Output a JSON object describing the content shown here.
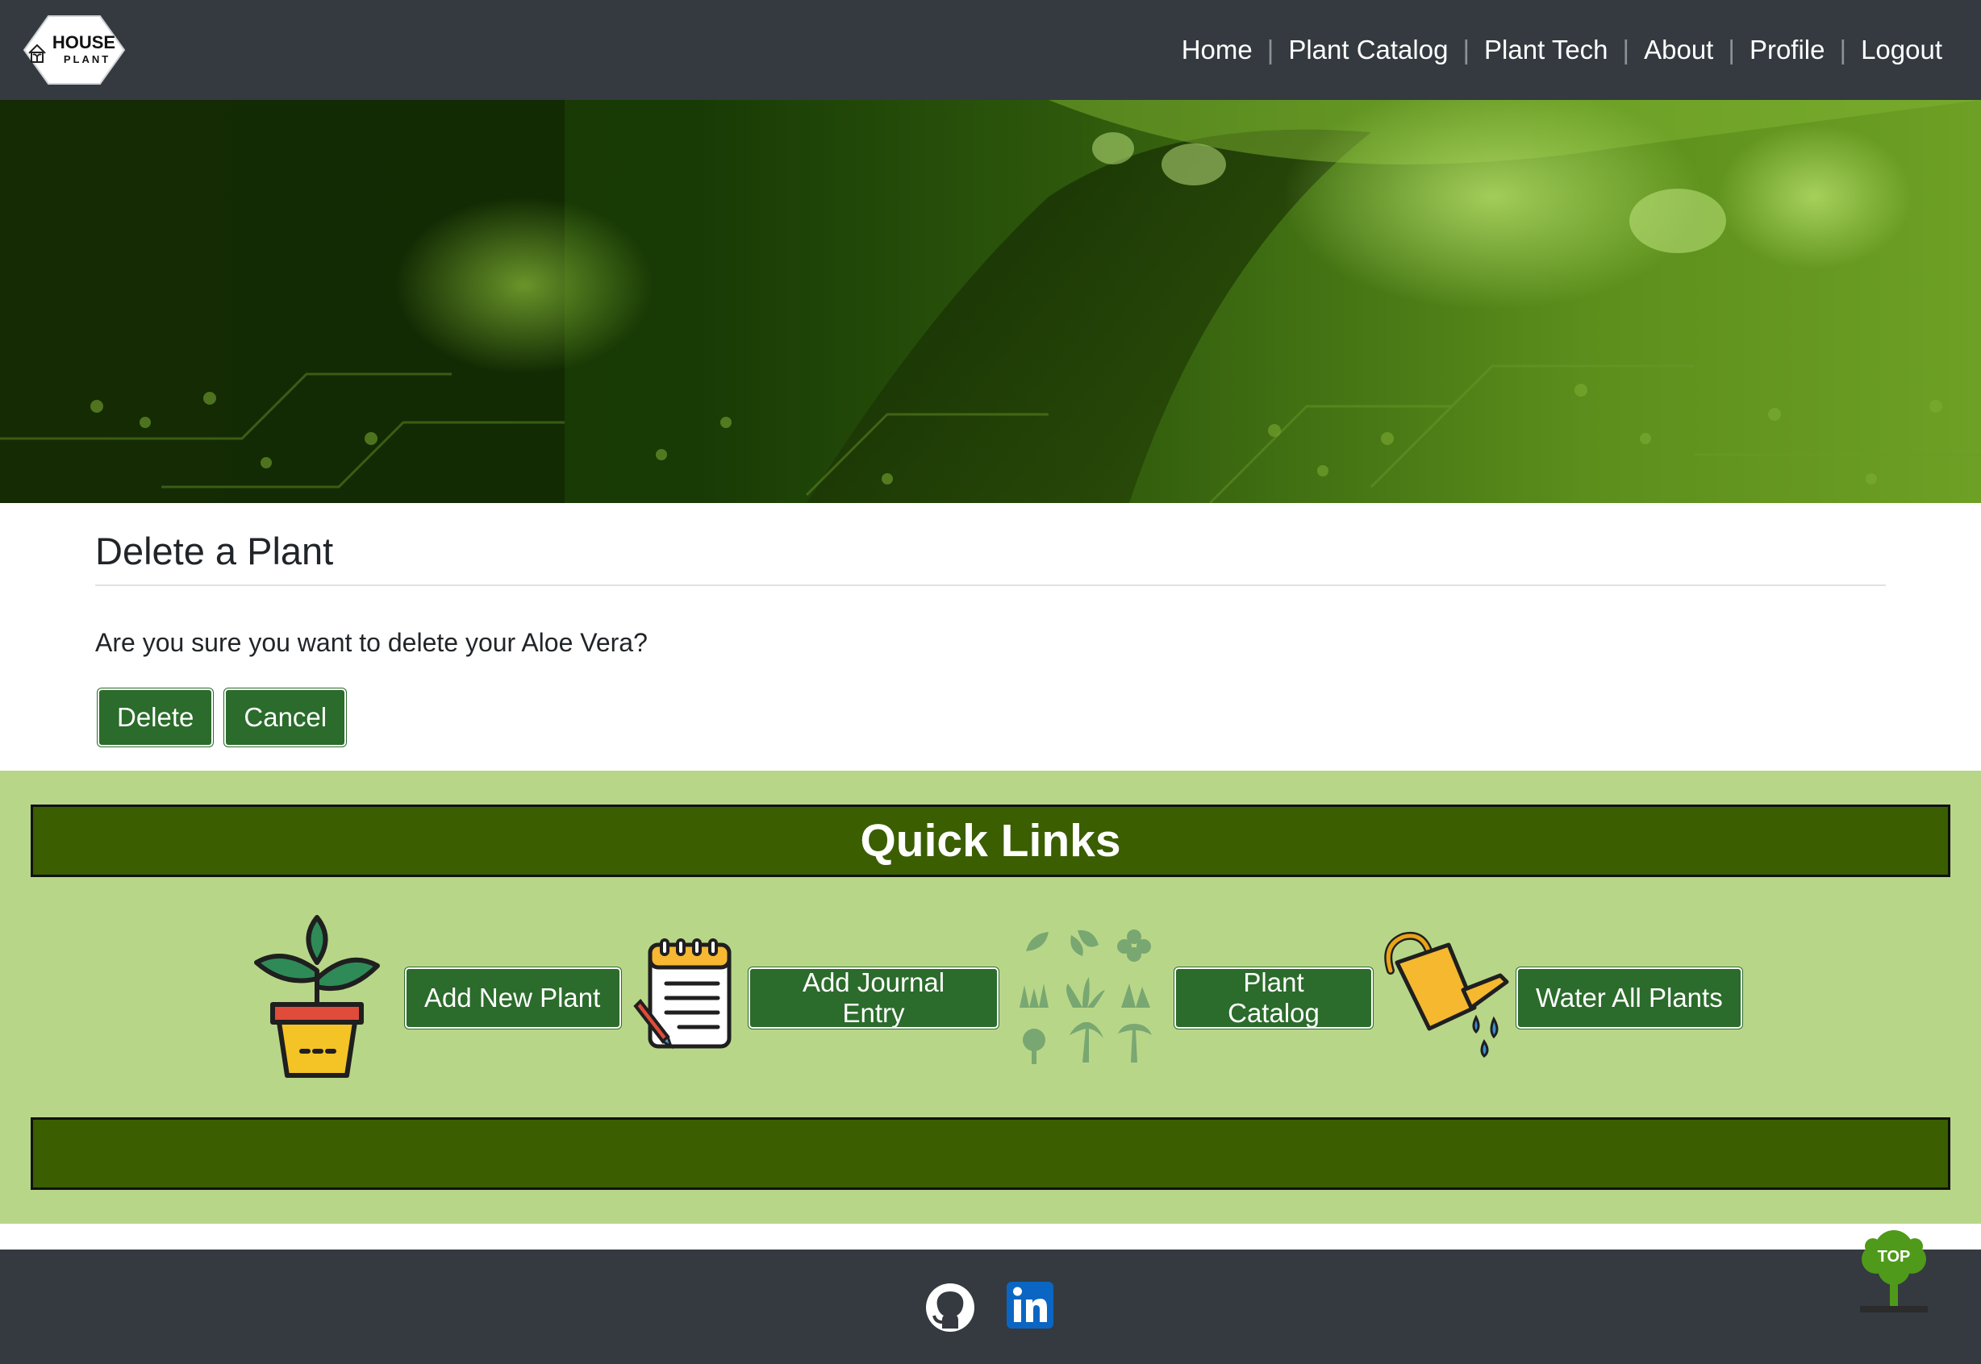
{
  "brand": {
    "logo_line1": "HOUSE",
    "logo_line2": "PLANT"
  },
  "nav": {
    "items": [
      "Home",
      "Plant Catalog",
      "Plant Tech",
      "About",
      "Profile",
      "Logout"
    ],
    "separator": "|"
  },
  "main": {
    "title": "Delete a Plant",
    "confirm_text": "Are you sure you want to delete your Aloe Vera?",
    "delete_label": "Delete",
    "cancel_label": "Cancel"
  },
  "quick_links": {
    "title": "Quick Links",
    "items": [
      {
        "icon": "potted-plant-icon",
        "label": "Add New Plant"
      },
      {
        "icon": "notepad-pencil-icon",
        "label": "Add Journal Entry"
      },
      {
        "icon": "plant-varieties-icon",
        "label": "Plant Catalog"
      },
      {
        "icon": "watering-can-icon",
        "label": "Water All Plants"
      }
    ]
  },
  "footer": {
    "icons": [
      "github-icon",
      "linkedin-icon"
    ],
    "top_label": "TOP"
  },
  "colors": {
    "navbar": "#343a40",
    "button_green": "#2b6b2b",
    "quick_links_bg": "#b8d688",
    "quick_links_bar": "#3a5e00",
    "linkedin_blue": "#0a66c2"
  }
}
